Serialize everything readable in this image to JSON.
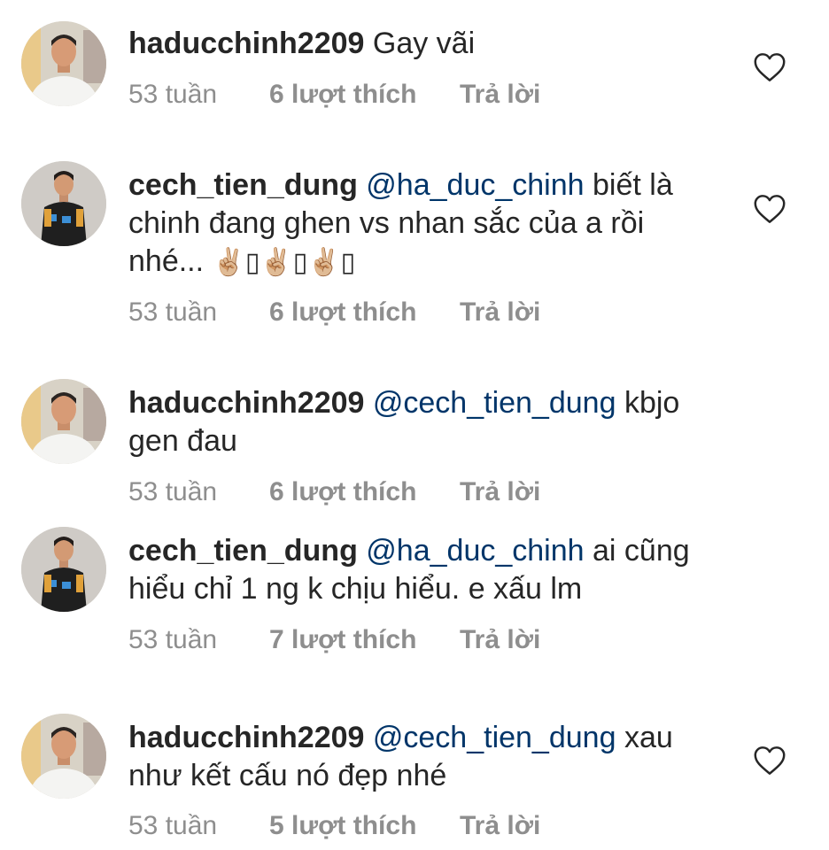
{
  "colors": {
    "text": "#262626",
    "meta": "#8e8e8e",
    "mention": "#003569",
    "background": "#ffffff"
  },
  "comments": [
    {
      "avatar": "avatar-white-shirt",
      "username": "haducchinh2209",
      "mention": "",
      "text": "Gay vãi",
      "emoji": "",
      "time": "53 tuần",
      "likes": "6 lượt thích",
      "reply": "Trả lời"
    },
    {
      "avatar": "avatar-goalkeeper",
      "username": "cech_tien_dung",
      "mention": "@ha_duc_chinh",
      "text": "biết là chinh đang ghen vs nhan sắc của a rồi nhé...",
      "emoji": "✌🏼▯✌🏼▯✌🏼▯",
      "time": "53 tuần",
      "likes": "6 lượt thích",
      "reply": "Trả lời"
    },
    {
      "avatar": "avatar-white-shirt",
      "username": "haducchinh2209",
      "mention": "@cech_tien_dung",
      "text": "kbjo gen đau",
      "emoji": "",
      "time": "53 tuần",
      "likes": "6 lượt thích",
      "reply": "Trả lời"
    },
    {
      "avatar": "avatar-goalkeeper",
      "username": "cech_tien_dung",
      "mention": "@ha_duc_chinh",
      "text": "ai cũng hiểu chỉ 1 ng k chịu hiểu. e xấu lm",
      "emoji": "",
      "time": "53 tuần",
      "likes": "7 lượt thích",
      "reply": "Trả lời"
    },
    {
      "avatar": "avatar-white-shirt",
      "username": "haducchinh2209",
      "mention": "@cech_tien_dung",
      "text": "xau như kết cấu nó đẹp nhé",
      "emoji": "",
      "time": "53 tuần",
      "likes": "5 lượt thích",
      "reply": "Trả lời"
    }
  ]
}
